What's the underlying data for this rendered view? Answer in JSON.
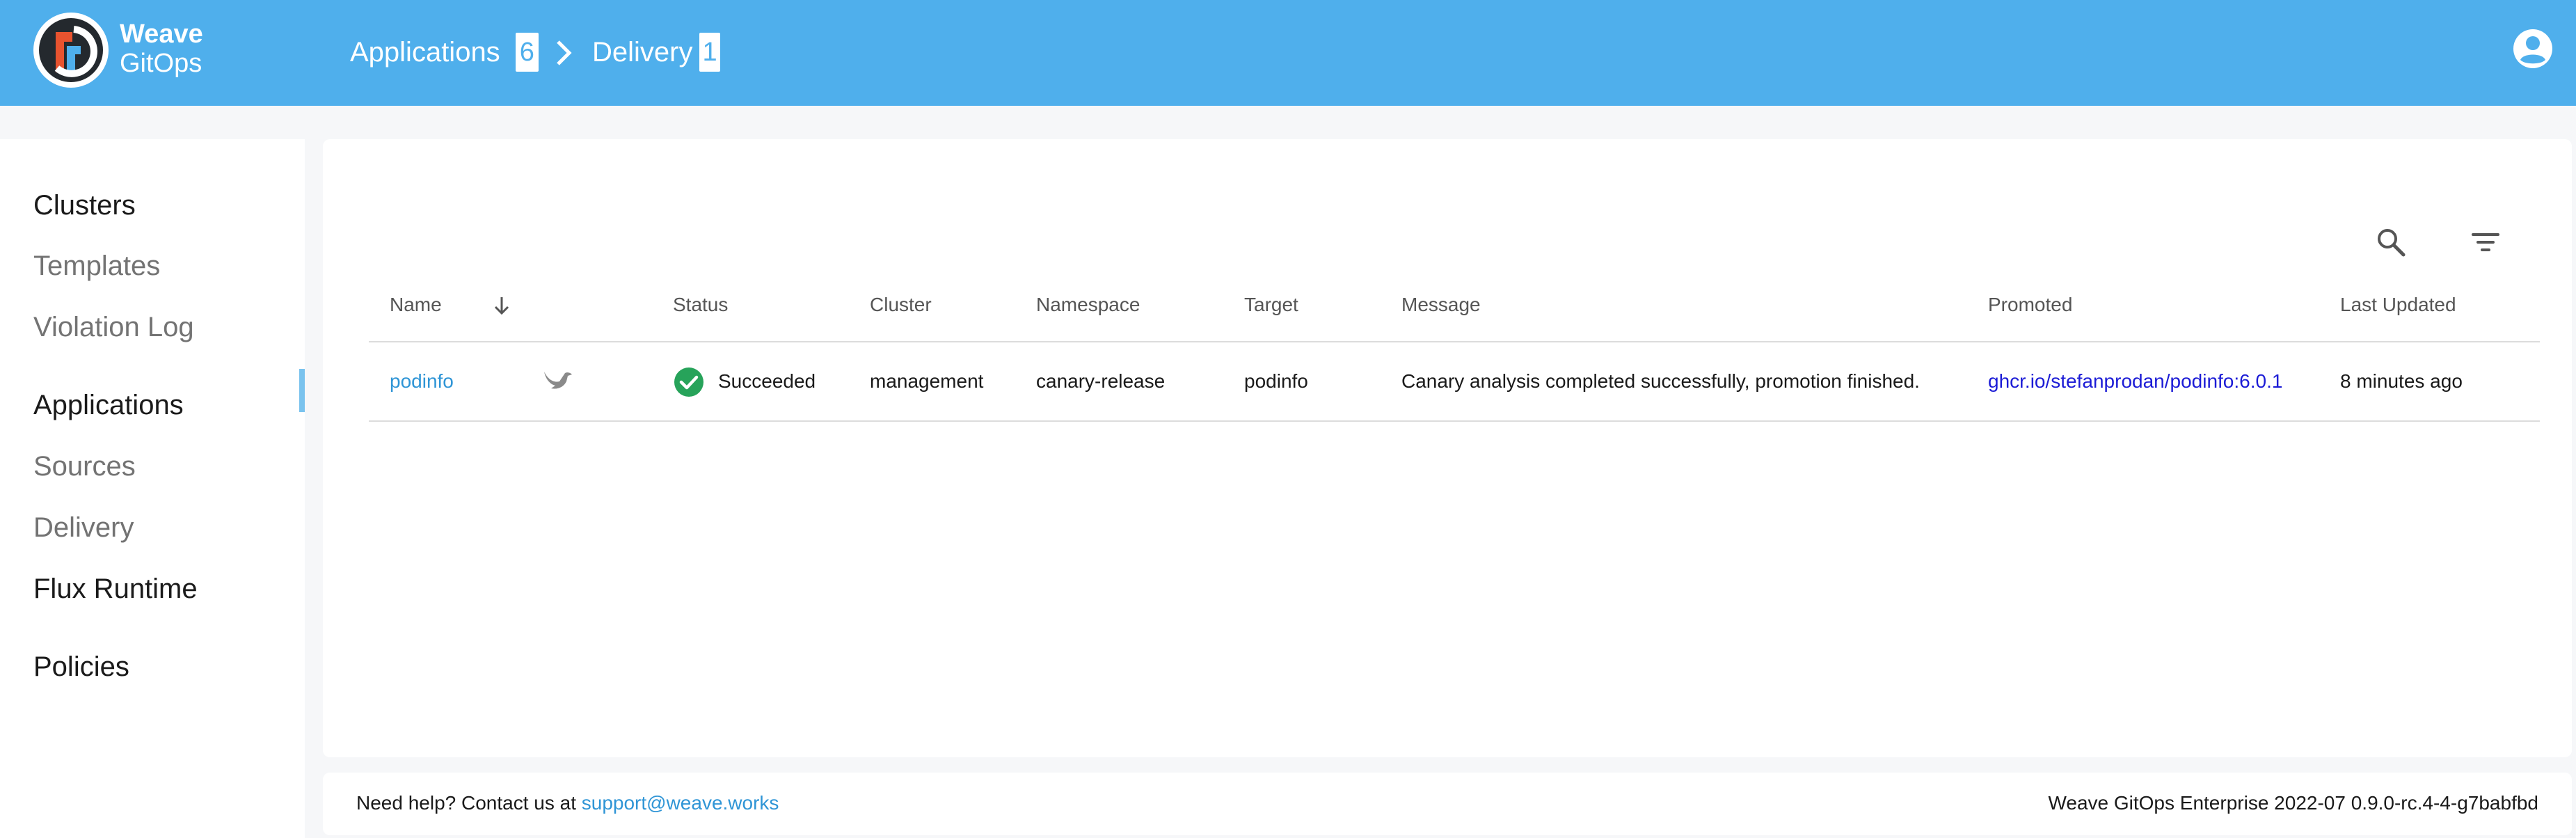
{
  "header": {
    "brand_top": "Weave",
    "brand_bottom": "GitOps",
    "breadcrumbs": [
      {
        "label": "Applications",
        "count": "6"
      },
      {
        "label": "Delivery",
        "count": "1"
      }
    ],
    "colors": {
      "bar": "#4fafec"
    }
  },
  "sidebar": {
    "items": [
      {
        "label": "Clusters",
        "kind": "main"
      },
      {
        "label": "Templates",
        "kind": "sub"
      },
      {
        "label": "Violation Log",
        "kind": "sub"
      },
      {
        "label": "Applications",
        "kind": "main"
      },
      {
        "label": "Sources",
        "kind": "sub"
      },
      {
        "label": "Delivery",
        "kind": "sub",
        "active": true
      },
      {
        "label": "Flux Runtime",
        "kind": "main"
      },
      {
        "label": "Policies",
        "kind": "main"
      }
    ]
  },
  "toolbar": {
    "search_icon": "search-icon",
    "filter_icon": "filter-icon"
  },
  "table": {
    "columns": [
      "Name",
      "Status",
      "Cluster",
      "Namespace",
      "Target",
      "Message",
      "Promoted",
      "Last Updated"
    ],
    "sort_icon": "arrow-down-icon",
    "rows": [
      {
        "name": "podinfo",
        "provider_icon": "flagger-bird-icon",
        "status": "Succeeded",
        "status_icon": "check-circle-icon",
        "cluster": "management",
        "namespace": "canary-release",
        "target": "podinfo",
        "message": "Canary analysis completed successfully, promotion finished.",
        "promoted": "ghcr.io/stefanprodan/podinfo:6.0.1",
        "last_updated": "8 minutes ago"
      }
    ]
  },
  "footer": {
    "help_text": "Need help? Contact us at ",
    "support_email": "support@weave.works",
    "version": "Weave GitOps Enterprise 2022-07 0.9.0-rc.4-4-g7babfbd"
  }
}
